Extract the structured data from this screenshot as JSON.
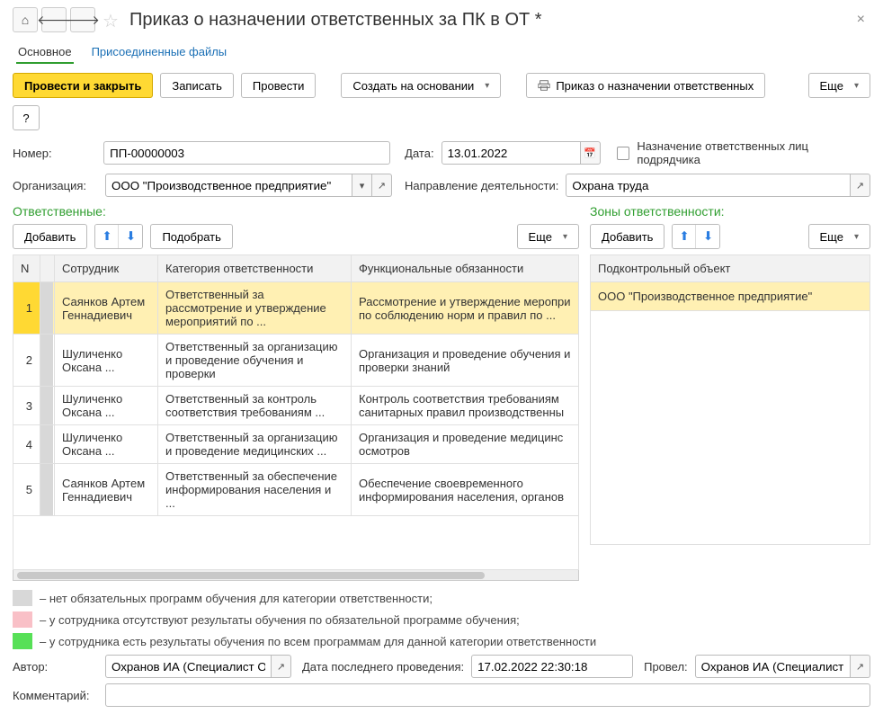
{
  "header": {
    "title": "Приказ о назначении ответственных за ПК в ОТ *"
  },
  "tabs": {
    "main": "Основное",
    "attached": "Присоединенные файлы"
  },
  "toolbar": {
    "post_close": "Провести и закрыть",
    "save": "Записать",
    "post": "Провести",
    "create_based": "Создать на основании",
    "print_order": "Приказ о назначении ответственных",
    "more": "Еще",
    "help": "?"
  },
  "fields": {
    "number_lbl": "Номер:",
    "number_val": "ПП-00000003",
    "date_lbl": "Дата:",
    "date_val": "13.01.2022",
    "checkbox_lbl": "Назначение ответственных лиц подрядчика",
    "org_lbl": "Организация:",
    "org_val": "ООО \"Производственное предприятие\"",
    "direction_lbl": "Направление деятельности:",
    "direction_val": "Охрана труда"
  },
  "left": {
    "title": "Ответственные:",
    "add": "Добавить",
    "pick": "Подобрать",
    "more": "Еще",
    "cols": {
      "n": "N",
      "emp": "Сотрудник",
      "cat": "Категория ответственности",
      "func": "Функциональные обязанности"
    },
    "rows": [
      {
        "n": "1",
        "emp": "Саянков Артем Геннадиевич",
        "cat": "Ответственный за рассмотрение и утверждение мероприятий по ...",
        "func": "Рассмотрение и утверждение меропри по соблюдению норм и правил по ..."
      },
      {
        "n": "2",
        "emp": "Шуличенко Оксана ...",
        "cat": "Ответственный за организацию и проведение обучения и проверки",
        "func": "Организация и проведение обучения и проверки знаний"
      },
      {
        "n": "3",
        "emp": "Шуличенко Оксана ...",
        "cat": "Ответственный за контроль соответствия требованиям ...",
        "func": "Контроль соответствия требованиям санитарных правил производственны"
      },
      {
        "n": "4",
        "emp": "Шуличенко Оксана ...",
        "cat": "Ответственный за организацию и проведение медицинских ...",
        "func": "Организация и проведение медицинс осмотров"
      },
      {
        "n": "5",
        "emp": "Саянков Артем Геннадиевич",
        "cat": "Ответственный за обеспечение информирования населения и ...",
        "func": "Обеспечение своевременного информирования населения, органов"
      }
    ]
  },
  "right": {
    "title": "Зоны ответственности:",
    "add": "Добавить",
    "more": "Еще",
    "col": "Подконтрольный объект",
    "rows": [
      {
        "val": "ООО \"Производственное предприятие\""
      }
    ]
  },
  "legend": {
    "gray": "– нет обязательных программ обучения для категории ответственности;",
    "pink": "– у сотрудника отсутствуют результаты обучения по обязательной программе обучения;",
    "green": "– у сотрудника есть результаты обучения по всем программам для данной категории ответственности"
  },
  "footer": {
    "author_lbl": "Автор:",
    "author_val": "Охранов ИА (Специалист ОТ)",
    "lastpost_lbl": "Дата последнего проведения:",
    "lastpost_val": "17.02.2022 22:30:18",
    "postedby_lbl": "Провел:",
    "postedby_val": "Охранов ИА (Специалист ОТ)",
    "comment_lbl": "Комментарий:"
  }
}
